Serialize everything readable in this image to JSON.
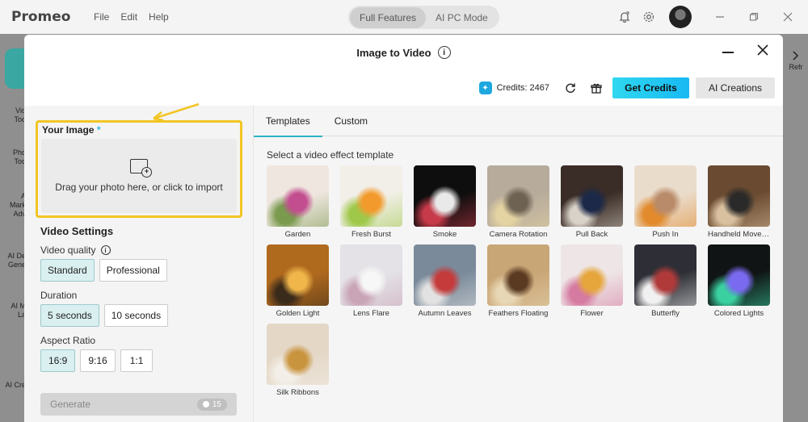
{
  "app": {
    "logo": "Promeo",
    "menu": [
      "File",
      "Edit",
      "Help"
    ],
    "modes": [
      "Full Features",
      "AI PC Mode"
    ],
    "active_mode": "Full Features"
  },
  "left_rail": {
    "items": [
      "Vid\nToo",
      "Pho\nToo",
      "A\nMark\nAdv",
      "AI De\nGene",
      "AI M\nLa",
      "AI Cre"
    ]
  },
  "right_rail": {
    "label": "Refr"
  },
  "dialog": {
    "title": "Image to Video",
    "credits_label": "Credits: 2467",
    "get_credits": "Get Credits",
    "ai_creations": "AI Creations"
  },
  "your_image": {
    "label": "Your Image",
    "required_mark": "*",
    "dropzone_text": "Drag your photo here, or click to import"
  },
  "video_settings": {
    "title": "Video Settings",
    "quality_label": "Video quality",
    "quality_options": [
      "Standard",
      "Professional"
    ],
    "quality_selected": "Standard",
    "duration_label": "Duration",
    "duration_options": [
      "5 seconds",
      "10 seconds"
    ],
    "duration_selected": "5 seconds",
    "aspect_label": "Aspect Ratio",
    "aspect_options": [
      "16:9",
      "9:16",
      "1:1"
    ],
    "aspect_selected": "16:9"
  },
  "generate": {
    "label": "Generate",
    "cost": "15"
  },
  "templates": {
    "tabs": [
      "Templates",
      "Custom"
    ],
    "active_tab": "Templates",
    "heading": "Select a video effect template",
    "items": [
      {
        "name": "Garden",
        "colors": [
          "#efe6df",
          "#c24d8f",
          "#7a9a4e"
        ]
      },
      {
        "name": "Fresh Burst",
        "colors": [
          "#f2efe8",
          "#f39a2c",
          "#9fc84a"
        ]
      },
      {
        "name": "Smoke",
        "colors": [
          "#0e0e0e",
          "#e9e9e9",
          "#c63a4a"
        ]
      },
      {
        "name": "Camera Rotation",
        "colors": [
          "#b7ab9c",
          "#6e6253",
          "#e4d3a2"
        ]
      },
      {
        "name": "Pull Back",
        "colors": [
          "#3a2c26",
          "#1c2948",
          "#d9d2c8"
        ]
      },
      {
        "name": "Push In",
        "colors": [
          "#eadccb",
          "#b98b6a",
          "#e28a2c"
        ]
      },
      {
        "name": "Handheld Movement",
        "colors": [
          "#6a4a30",
          "#2a2a2a",
          "#d9c1a0"
        ]
      },
      {
        "name": "Golden Light",
        "colors": [
          "#b06a1e",
          "#f0b64a",
          "#3a2a1a"
        ]
      },
      {
        "name": "Lens Flare",
        "colors": [
          "#e4e2e6",
          "#f7f7f7",
          "#c9a3b6"
        ]
      },
      {
        "name": "Autumn Leaves",
        "colors": [
          "#7a8a9a",
          "#c53a3a",
          "#e2e2e2"
        ]
      },
      {
        "name": "Feathers Floating",
        "colors": [
          "#c9a676",
          "#5b3a22",
          "#e8d7b4"
        ]
      },
      {
        "name": "Flower",
        "colors": [
          "#eee6e6",
          "#e6a63c",
          "#d57aa0"
        ]
      },
      {
        "name": "Butterfly",
        "colors": [
          "#2e2f36",
          "#b03a3a",
          "#f1f1f1"
        ]
      },
      {
        "name": "Colored Lights",
        "colors": [
          "#101414",
          "#7a6af0",
          "#3ad0a0"
        ]
      },
      {
        "name": "Silk Ribbons",
        "colors": [
          "#e4d7c6",
          "#c9943e",
          "#f3efe8"
        ]
      }
    ]
  },
  "icons": {
    "bell": "bell-icon",
    "gear": "gear-icon",
    "info": "info-icon",
    "refresh": "refresh-icon",
    "gift": "gift-icon",
    "credit": "credit-icon",
    "image_add": "image-add-icon"
  },
  "colors": {
    "accent": "#2bb6c2",
    "highlight": "#f2c524",
    "get_credits_bg": "#18b9f2"
  }
}
